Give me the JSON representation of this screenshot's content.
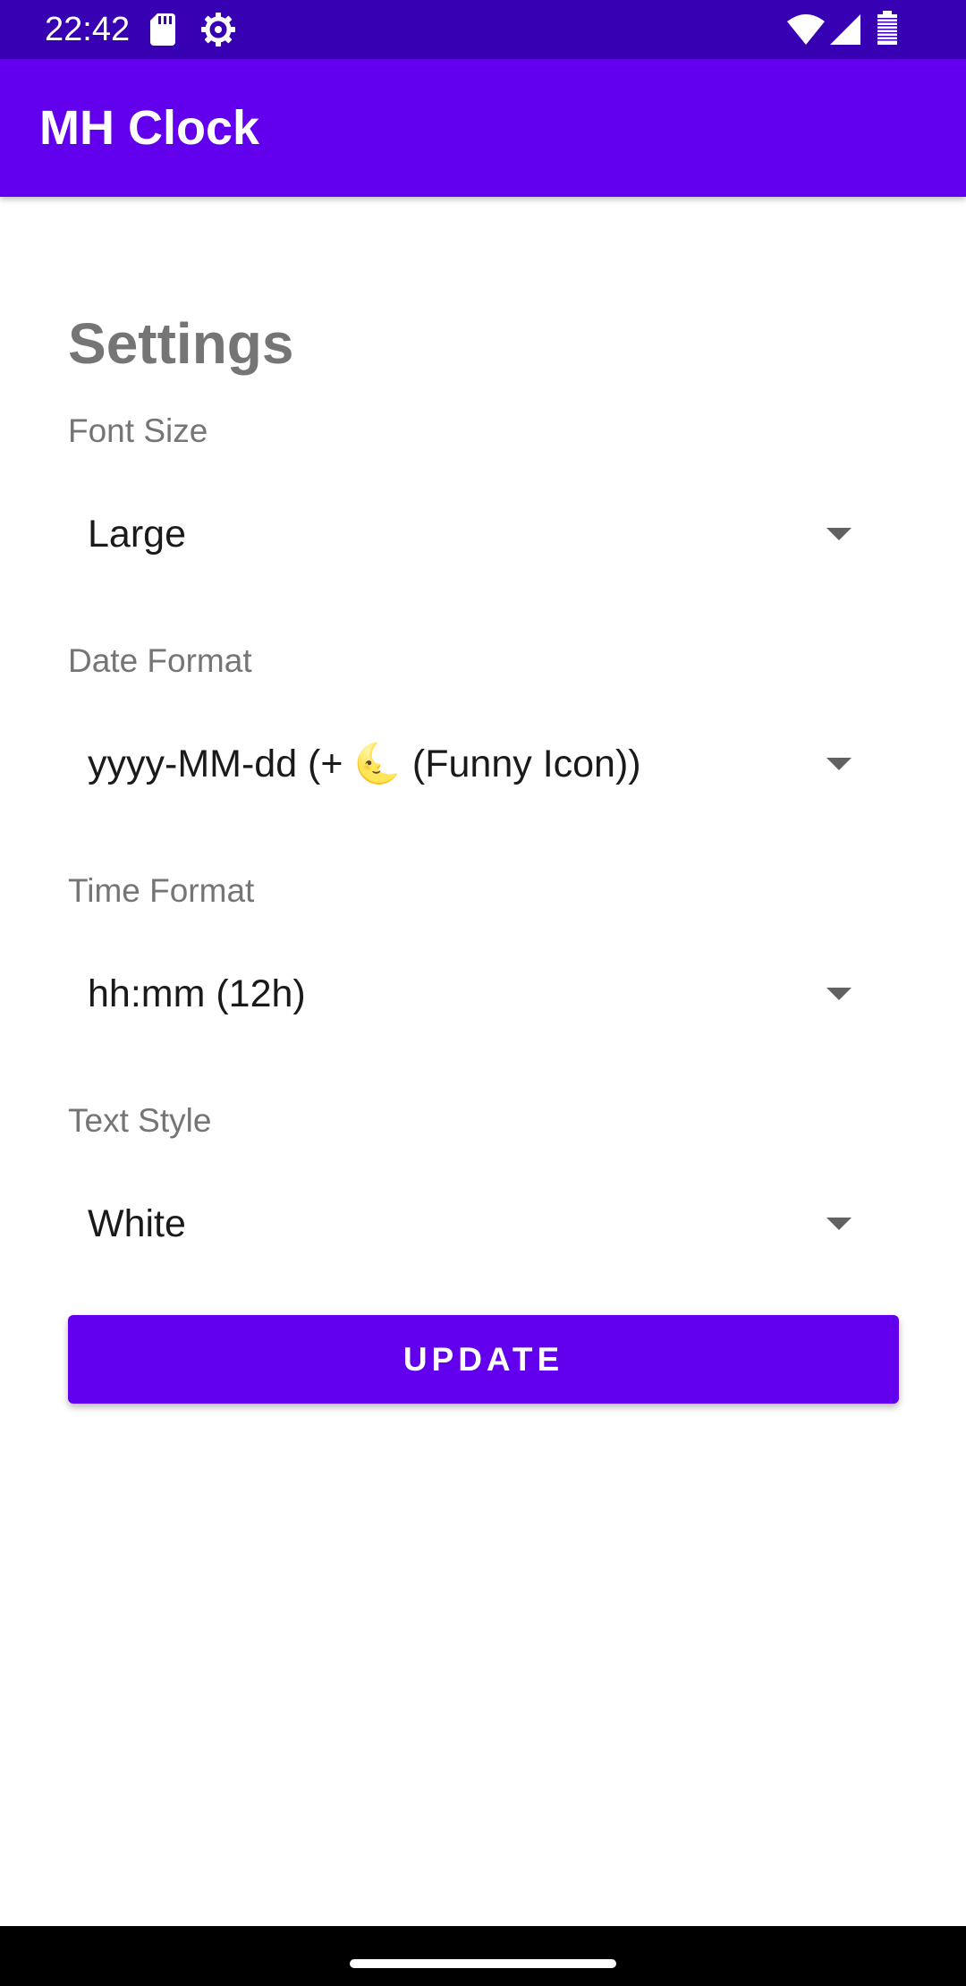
{
  "status_bar": {
    "time": "22:42",
    "icons": [
      "sd-card-icon",
      "settings-gear-icon",
      "wifi-icon",
      "cell-signal-icon",
      "battery-icon"
    ]
  },
  "app_bar": {
    "title": "MH Clock"
  },
  "settings": {
    "heading": "Settings",
    "fields": [
      {
        "label": "Font Size",
        "value": "Large"
      },
      {
        "label": "Date Format",
        "value": "yyyy-MM-dd (+ 🌜 (Funny Icon))"
      },
      {
        "label": "Time Format",
        "value": "hh:mm (12h)"
      },
      {
        "label": "Text Style",
        "value": "White"
      }
    ],
    "update_label": "UPDATE"
  },
  "colors": {
    "status_bar": "#3700b3",
    "primary": "#6200ee",
    "label_gray": "#757575"
  }
}
